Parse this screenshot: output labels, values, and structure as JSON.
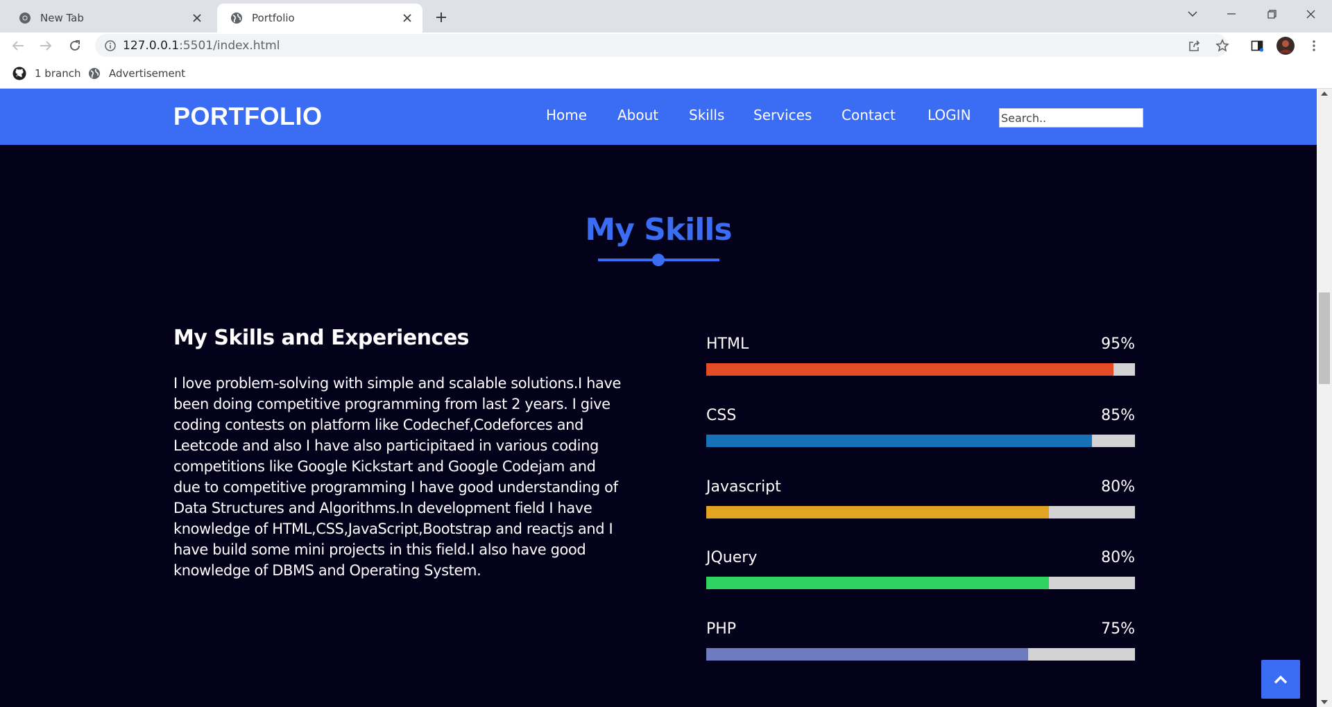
{
  "browser": {
    "tabs": [
      {
        "title": "New Tab",
        "active": false,
        "icon": "chrome-icon"
      },
      {
        "title": "Portfolio",
        "active": true,
        "icon": "globe-icon"
      }
    ],
    "url_host": "127.0.0.1",
    "url_rest": ":5501/index.html",
    "bookmarks": [
      {
        "label": "1 branch",
        "icon": "github-icon"
      },
      {
        "label": "Advertisement",
        "icon": "globe-icon"
      }
    ]
  },
  "site": {
    "logo": "PORTFOLIO",
    "menu": [
      "Home",
      "About",
      "Skills",
      "Services",
      "Contact",
      "LOGIN"
    ],
    "search_placeholder": "Search..",
    "accent_color": "#3a6cf4",
    "background_color": "#03021a"
  },
  "skills_section": {
    "title": "My Skills",
    "heading": "My Skills and Experiences",
    "paragraph": "I love problem-solving with simple and scalable solutions.I have been doing competitive programming from last 2 years. I give coding contests on platform like Codechef,Codeforces and Leetcode and also I have also participitaed in various coding competitions like Google Kickstart and Google Codejam and due to competitive programming I have good understanding of Data Structures and Algorithms.In development field I have knowledge of HTML,CSS,JavaScript,Bootstrap and reactjs and I have build some mini projects in this field.I also have good knowledge of DBMS and Operating System.",
    "skills": [
      {
        "name": "HTML",
        "percent_label": "95%",
        "level": 95,
        "color": "#e34c26"
      },
      {
        "name": "CSS",
        "percent_label": "85%",
        "level": 90,
        "color": "#1572b6"
      },
      {
        "name": "Javascript",
        "percent_label": "80%",
        "level": 80,
        "color": "#e3a424"
      },
      {
        "name": "JQuery",
        "percent_label": "80%",
        "level": 80,
        "color": "#2fd35f"
      },
      {
        "name": "PHP",
        "percent_label": "75%",
        "level": 75,
        "color": "#6e7bbf"
      }
    ]
  }
}
